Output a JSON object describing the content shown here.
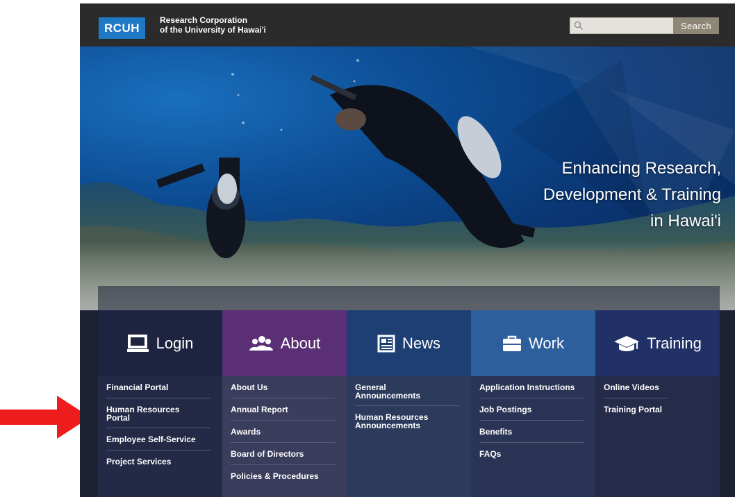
{
  "header": {
    "logo": "RCUH",
    "org_line1": "Research Corporation",
    "org_line2": "of the University of Hawai'i",
    "search_placeholder": "",
    "search_button": "Search"
  },
  "hero": {
    "line1": "Enhancing Research,",
    "line2": "Development & Training",
    "line3": "in Hawai'i"
  },
  "nav": {
    "login": {
      "title": "Login",
      "icon": "monitor-icon",
      "links": [
        "Financial Portal",
        "Human Resources Portal",
        "Employee Self-Service",
        "Project Services"
      ]
    },
    "about": {
      "title": "About",
      "icon": "people-icon",
      "links": [
        "About Us",
        "Annual Report",
        "Awards",
        "Board of Directors",
        "Policies & Procedures"
      ]
    },
    "news": {
      "title": "News",
      "icon": "newspaper-icon",
      "links": [
        "General Announcements",
        "Human Resources Announcements"
      ]
    },
    "work": {
      "title": "Work",
      "icon": "briefcase-icon",
      "links": [
        "Application Instructions",
        "Job Postings",
        "Benefits",
        "FAQs"
      ]
    },
    "training": {
      "title": "Training",
      "icon": "graduation-cap-icon",
      "links": [
        "Online Videos",
        "Training Portal"
      ]
    }
  },
  "colors": {
    "accent_blue": "#1f79c4",
    "arrow_red": "#ee1c1c",
    "header_bg": "#2b2b2b"
  }
}
